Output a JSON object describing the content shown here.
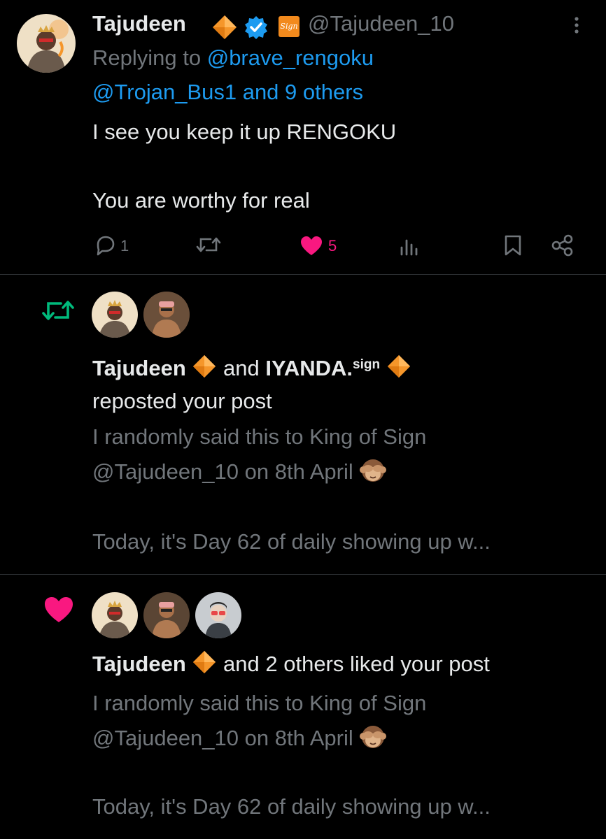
{
  "reply": {
    "author_name": "Tajudeen",
    "author_handle": "@Tajudeen_10",
    "replying_prefix": "Replying to",
    "replying_user": "@brave_rengoku",
    "replying_others": "@Trojan_Bus1 and 9 others",
    "body_line1": "I see you keep it up RENGOKU",
    "body_line2": "You  are worthy for real",
    "reply_count": "1",
    "like_count": "5",
    "badge_label": "Sign"
  },
  "repost_notification": {
    "name1": "Tajudeen",
    "connector": "and",
    "name2": "IYANDA.",
    "name2_suffix": "sign",
    "action": "reposted your post",
    "preview_line1": "I randomly said this to King of Sign",
    "preview_line2": "@Tajudeen_10 on 8th April",
    "preview_line3": "Today, it's Day 62 of daily showing up w..."
  },
  "like_notification": {
    "name1": "Tajudeen",
    "action": "and 2 others liked your post",
    "preview_line1": "I randomly said this to King of Sign",
    "preview_line2": "@Tajudeen_10 on 8th April",
    "preview_line3": "Today, it's Day 62 of daily showing up w..."
  },
  "colors": {
    "background": "#000000",
    "text_primary": "#e7e9ea",
    "text_secondary": "#71767b",
    "link_blue": "#1d9bf0",
    "like_pink": "#f91880",
    "repost_green": "#00ba7c",
    "gem_orange": "#f5962a"
  }
}
